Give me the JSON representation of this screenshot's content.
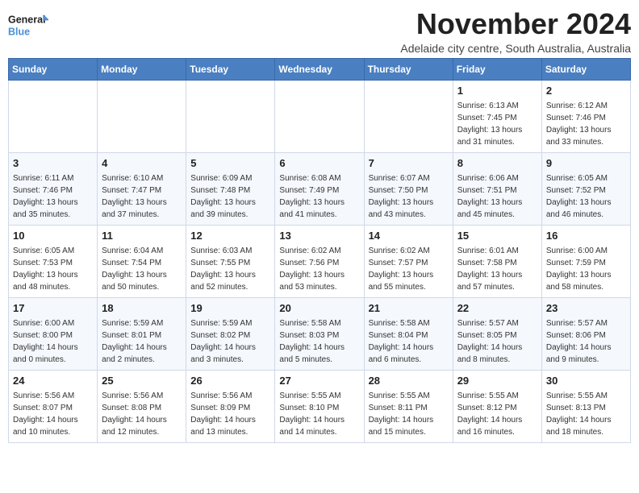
{
  "header": {
    "logo_line1": "General",
    "logo_line2": "Blue",
    "month_title": "November 2024",
    "location": "Adelaide city centre, South Australia, Australia"
  },
  "weekdays": [
    "Sunday",
    "Monday",
    "Tuesday",
    "Wednesday",
    "Thursday",
    "Friday",
    "Saturday"
  ],
  "weeks": [
    [
      {
        "day": "",
        "info": ""
      },
      {
        "day": "",
        "info": ""
      },
      {
        "day": "",
        "info": ""
      },
      {
        "day": "",
        "info": ""
      },
      {
        "day": "",
        "info": ""
      },
      {
        "day": "1",
        "info": "Sunrise: 6:13 AM\nSunset: 7:45 PM\nDaylight: 13 hours\nand 31 minutes."
      },
      {
        "day": "2",
        "info": "Sunrise: 6:12 AM\nSunset: 7:46 PM\nDaylight: 13 hours\nand 33 minutes."
      }
    ],
    [
      {
        "day": "3",
        "info": "Sunrise: 6:11 AM\nSunset: 7:46 PM\nDaylight: 13 hours\nand 35 minutes."
      },
      {
        "day": "4",
        "info": "Sunrise: 6:10 AM\nSunset: 7:47 PM\nDaylight: 13 hours\nand 37 minutes."
      },
      {
        "day": "5",
        "info": "Sunrise: 6:09 AM\nSunset: 7:48 PM\nDaylight: 13 hours\nand 39 minutes."
      },
      {
        "day": "6",
        "info": "Sunrise: 6:08 AM\nSunset: 7:49 PM\nDaylight: 13 hours\nand 41 minutes."
      },
      {
        "day": "7",
        "info": "Sunrise: 6:07 AM\nSunset: 7:50 PM\nDaylight: 13 hours\nand 43 minutes."
      },
      {
        "day": "8",
        "info": "Sunrise: 6:06 AM\nSunset: 7:51 PM\nDaylight: 13 hours\nand 45 minutes."
      },
      {
        "day": "9",
        "info": "Sunrise: 6:05 AM\nSunset: 7:52 PM\nDaylight: 13 hours\nand 46 minutes."
      }
    ],
    [
      {
        "day": "10",
        "info": "Sunrise: 6:05 AM\nSunset: 7:53 PM\nDaylight: 13 hours\nand 48 minutes."
      },
      {
        "day": "11",
        "info": "Sunrise: 6:04 AM\nSunset: 7:54 PM\nDaylight: 13 hours\nand 50 minutes."
      },
      {
        "day": "12",
        "info": "Sunrise: 6:03 AM\nSunset: 7:55 PM\nDaylight: 13 hours\nand 52 minutes."
      },
      {
        "day": "13",
        "info": "Sunrise: 6:02 AM\nSunset: 7:56 PM\nDaylight: 13 hours\nand 53 minutes."
      },
      {
        "day": "14",
        "info": "Sunrise: 6:02 AM\nSunset: 7:57 PM\nDaylight: 13 hours\nand 55 minutes."
      },
      {
        "day": "15",
        "info": "Sunrise: 6:01 AM\nSunset: 7:58 PM\nDaylight: 13 hours\nand 57 minutes."
      },
      {
        "day": "16",
        "info": "Sunrise: 6:00 AM\nSunset: 7:59 PM\nDaylight: 13 hours\nand 58 minutes."
      }
    ],
    [
      {
        "day": "17",
        "info": "Sunrise: 6:00 AM\nSunset: 8:00 PM\nDaylight: 14 hours\nand 0 minutes."
      },
      {
        "day": "18",
        "info": "Sunrise: 5:59 AM\nSunset: 8:01 PM\nDaylight: 14 hours\nand 2 minutes."
      },
      {
        "day": "19",
        "info": "Sunrise: 5:59 AM\nSunset: 8:02 PM\nDaylight: 14 hours\nand 3 minutes."
      },
      {
        "day": "20",
        "info": "Sunrise: 5:58 AM\nSunset: 8:03 PM\nDaylight: 14 hours\nand 5 minutes."
      },
      {
        "day": "21",
        "info": "Sunrise: 5:58 AM\nSunset: 8:04 PM\nDaylight: 14 hours\nand 6 minutes."
      },
      {
        "day": "22",
        "info": "Sunrise: 5:57 AM\nSunset: 8:05 PM\nDaylight: 14 hours\nand 8 minutes."
      },
      {
        "day": "23",
        "info": "Sunrise: 5:57 AM\nSunset: 8:06 PM\nDaylight: 14 hours\nand 9 minutes."
      }
    ],
    [
      {
        "day": "24",
        "info": "Sunrise: 5:56 AM\nSunset: 8:07 PM\nDaylight: 14 hours\nand 10 minutes."
      },
      {
        "day": "25",
        "info": "Sunrise: 5:56 AM\nSunset: 8:08 PM\nDaylight: 14 hours\nand 12 minutes."
      },
      {
        "day": "26",
        "info": "Sunrise: 5:56 AM\nSunset: 8:09 PM\nDaylight: 14 hours\nand 13 minutes."
      },
      {
        "day": "27",
        "info": "Sunrise: 5:55 AM\nSunset: 8:10 PM\nDaylight: 14 hours\nand 14 minutes."
      },
      {
        "day": "28",
        "info": "Sunrise: 5:55 AM\nSunset: 8:11 PM\nDaylight: 14 hours\nand 15 minutes."
      },
      {
        "day": "29",
        "info": "Sunrise: 5:55 AM\nSunset: 8:12 PM\nDaylight: 14 hours\nand 16 minutes."
      },
      {
        "day": "30",
        "info": "Sunrise: 5:55 AM\nSunset: 8:13 PM\nDaylight: 14 hours\nand 18 minutes."
      }
    ]
  ]
}
